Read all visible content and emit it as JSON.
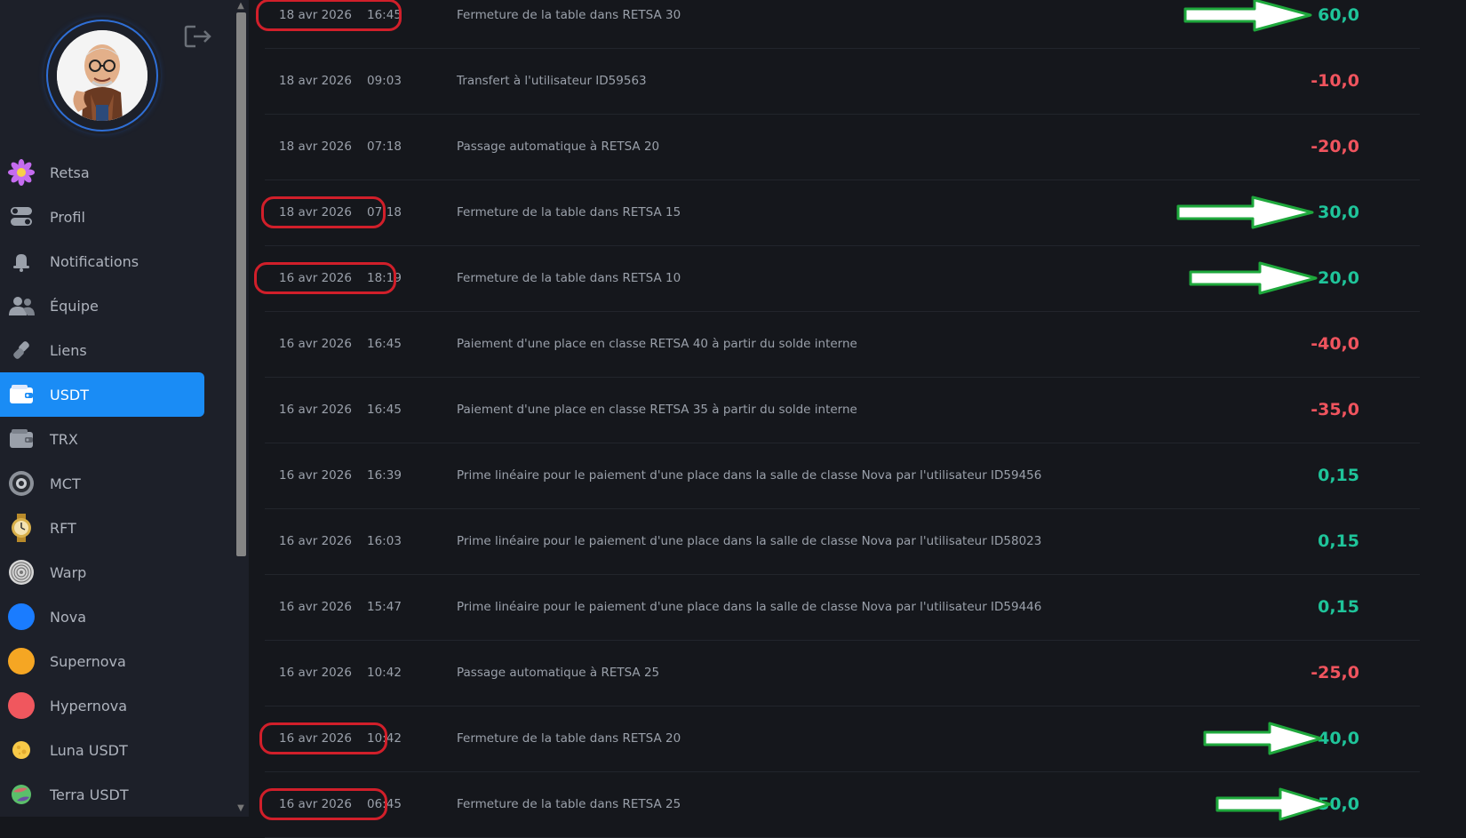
{
  "sidebar": {
    "items": [
      {
        "label": "Retsa",
        "icon": "flower-icon",
        "color": "#c56cf0"
      },
      {
        "label": "Profil",
        "icon": "toggle-icon",
        "color": "#a0a4ad"
      },
      {
        "label": "Notifications",
        "icon": "bell-icon",
        "color": "#a0a4ad"
      },
      {
        "label": "Équipe",
        "icon": "team-icon",
        "color": "#a0a4ad"
      },
      {
        "label": "Liens",
        "icon": "link-icon",
        "color": "#a0a4ad"
      },
      {
        "label": "USDT",
        "icon": "wallet-icon",
        "color": "#ffffff",
        "active": true
      },
      {
        "label": "TRX",
        "icon": "wallet-icon",
        "color": "#a0a4ad"
      },
      {
        "label": "MCT",
        "icon": "eye-coin-icon",
        "color": "#a0a4ad"
      },
      {
        "label": "RFT",
        "icon": "watch-icon",
        "color": "#d9b04a"
      },
      {
        "label": "Warp",
        "icon": "spiral-icon",
        "color": "#cccccc"
      },
      {
        "label": "Nova",
        "icon": "blue-circle-icon",
        "color": "#1a7cff"
      },
      {
        "label": "Supernova",
        "icon": "orange-circle-icon",
        "color": "#f5a623"
      },
      {
        "label": "Hypernova",
        "icon": "red-circle-icon",
        "color": "#f0575e"
      },
      {
        "label": "Luna USDT",
        "icon": "moon-icon",
        "color": "#f7c948"
      },
      {
        "label": "Terra USDT",
        "icon": "planet-icon",
        "color": "#5bbf6a"
      }
    ]
  },
  "transactions": [
    {
      "date": "18 avr 2026",
      "time": "16:45",
      "description": "Fermeture de la table dans RETSA 30",
      "amount": "60,0",
      "sign": "pos"
    },
    {
      "date": "18 avr 2026",
      "time": "09:03",
      "description": "Transfert à l'utilisateur ID59563",
      "amount": "-10,0",
      "sign": "neg"
    },
    {
      "date": "18 avr 2026",
      "time": "07:18",
      "description": "Passage automatique à RETSA 20",
      "amount": "-20,0",
      "sign": "neg"
    },
    {
      "date": "18 avr 2026",
      "time": "07:18",
      "description": "Fermeture de la table dans RETSA 15",
      "amount": "30,0",
      "sign": "pos"
    },
    {
      "date": "16 avr 2026",
      "time": "18:19",
      "description": "Fermeture de la table dans RETSA 10",
      "amount": "20,0",
      "sign": "pos"
    },
    {
      "date": "16 avr 2026",
      "time": "16:45",
      "description": "Paiement d'une place en classe RETSA 40 à partir du solde interne",
      "amount": "-40,0",
      "sign": "neg"
    },
    {
      "date": "16 avr 2026",
      "time": "16:45",
      "description": "Paiement d'une place en classe RETSA 35 à partir du solde interne",
      "amount": "-35,0",
      "sign": "neg"
    },
    {
      "date": "16 avr 2026",
      "time": "16:39",
      "description": "Prime linéaire pour le paiement d'une place dans la salle de classe Nova par l'utilisateur ID59456",
      "amount": "0,15",
      "sign": "pos"
    },
    {
      "date": "16 avr 2026",
      "time": "16:03",
      "description": "Prime linéaire pour le paiement d'une place dans la salle de classe Nova par l'utilisateur ID58023",
      "amount": "0,15",
      "sign": "pos"
    },
    {
      "date": "16 avr 2026",
      "time": "15:47",
      "description": "Prime linéaire pour le paiement d'une place dans la salle de classe Nova par l'utilisateur ID59446",
      "amount": "0,15",
      "sign": "pos"
    },
    {
      "date": "16 avr 2026",
      "time": "10:42",
      "description": "Passage automatique à RETSA 25",
      "amount": "-25,0",
      "sign": "neg"
    },
    {
      "date": "16 avr 2026",
      "time": "10:42",
      "description": "Fermeture de la table dans RETSA 20",
      "amount": "40,0",
      "sign": "pos"
    },
    {
      "date": "16 avr 2026",
      "time": "06:45",
      "description": "Fermeture de la table dans RETSA 25",
      "amount": "50,0",
      "sign": "pos"
    }
  ],
  "annotations": {
    "highlight_color": "#d11f2a",
    "arrow_fill": "#ffffff",
    "arrow_stroke": "#1ea83c"
  },
  "colors": {
    "accent": "#1a8cf5",
    "positive": "#1fc49a",
    "negative": "#f0545e"
  }
}
